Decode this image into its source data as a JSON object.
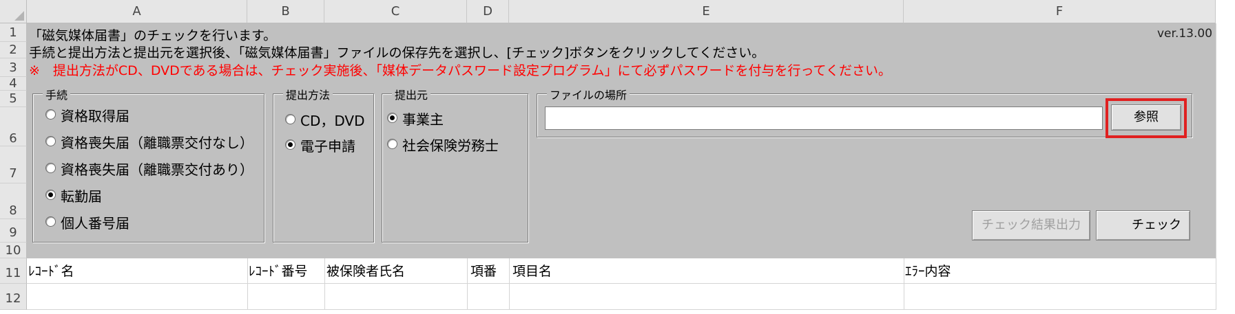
{
  "columns": [
    "A",
    "B",
    "C",
    "D",
    "E",
    "F"
  ],
  "rows": [
    "1",
    "2",
    "3",
    "4",
    "5",
    "6",
    "7",
    "8",
    "9",
    "10",
    "11",
    "12"
  ],
  "info": {
    "line1": "「磁気媒体届書」のチェックを行います。",
    "line2": "手続と提出方法と提出元を選択後、「磁気媒体届書」ファイルの保存先を選択し、[チェック]ボタンをクリックしてください。",
    "line3": "※　提出方法がCD、DVDである場合は、チェック実施後、「媒体データパスワード設定プログラム」にて必ずパスワードを付与を行ってください。",
    "version": "ver.13.00"
  },
  "procedure": {
    "label": "手続",
    "options": [
      "資格取得届",
      "資格喪失届（離職票交付なし）",
      "資格喪失届（離職票交付あり）",
      "転勤届",
      "個人番号届"
    ],
    "selected": "転勤届"
  },
  "method": {
    "label": "提出方法",
    "options": [
      "CD，DVD",
      "電子申請"
    ],
    "selected": "電子申請"
  },
  "source": {
    "label": "提出元",
    "options": [
      "事業主",
      "社会保険労務士"
    ],
    "selected": "事業主"
  },
  "file": {
    "label": "ファイルの場所",
    "value": "",
    "browse_label": "参照"
  },
  "buttons": {
    "output_label": "チェック結果出力",
    "check_label": "チェック"
  },
  "table_headers": [
    "ﾚｺｰﾄﾞ名",
    "ﾚｺｰﾄﾞ番号",
    "被保険者氏名",
    "項番",
    "項目名",
    "ｴﾗｰ内容"
  ],
  "colors": {
    "panel": "#c0c0c0",
    "warning": "#ff0000",
    "highlight": "#e02020"
  }
}
